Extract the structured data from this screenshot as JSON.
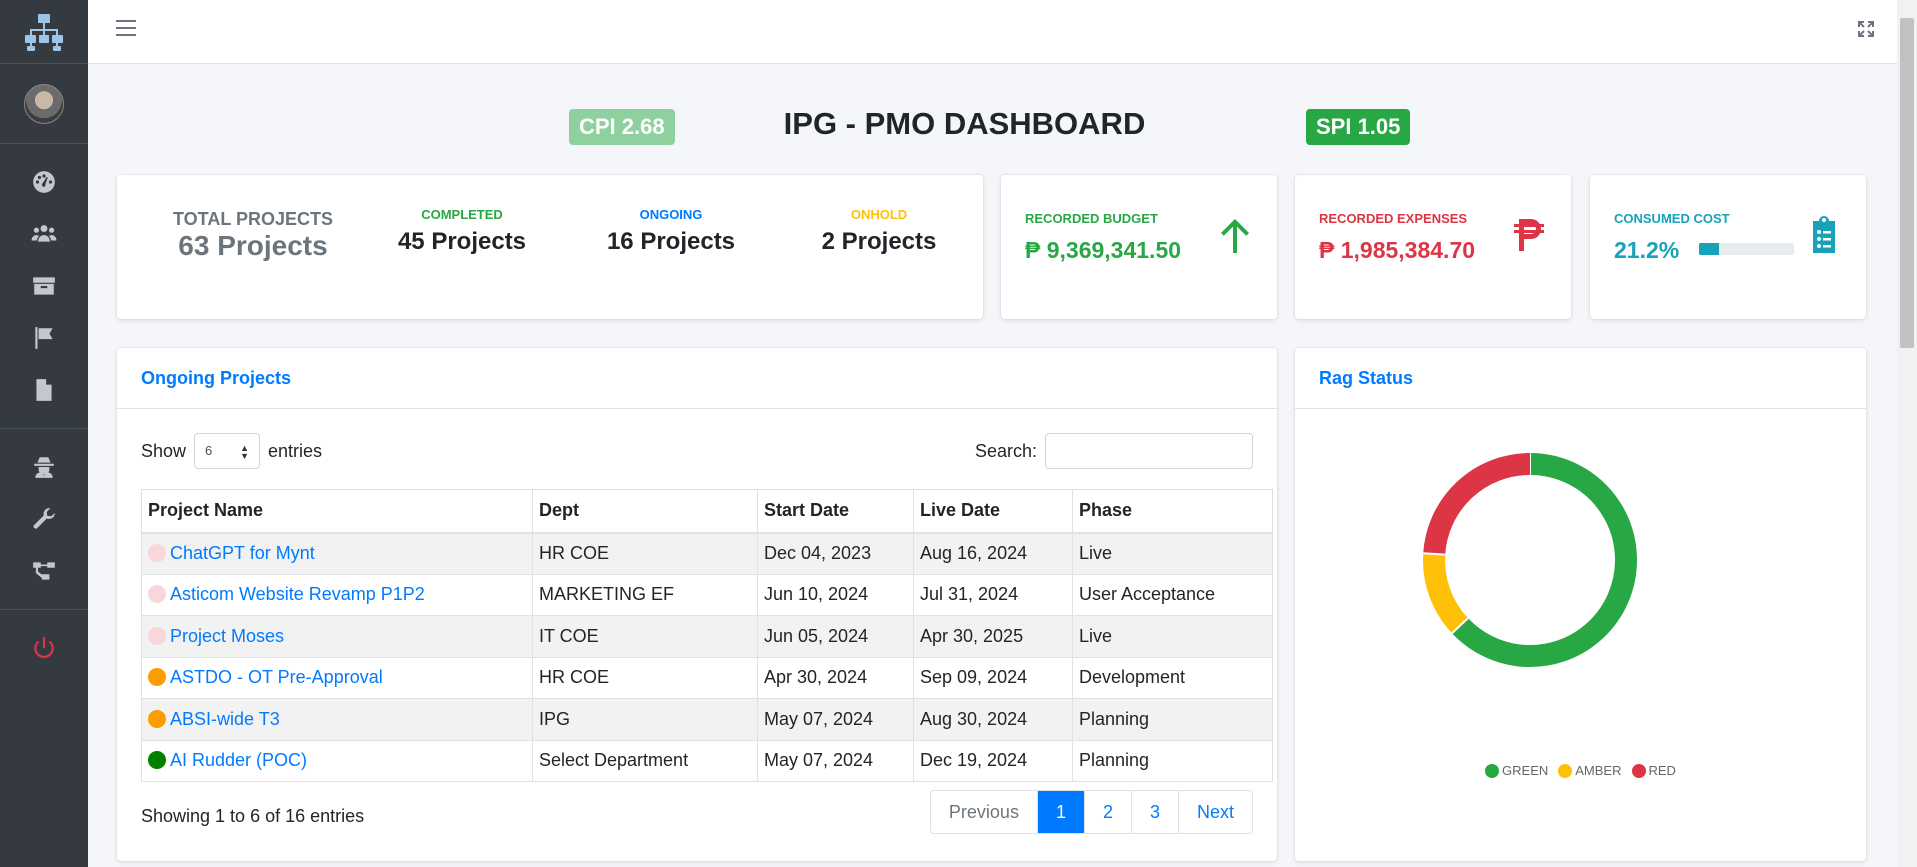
{
  "header": {
    "title": "IPG - PMO DASHBOARD",
    "cpi": "CPI 2.68",
    "spi": "SPI 1.05"
  },
  "stats": {
    "total_label": "TOTAL PROJECTS",
    "total_value": "63 Projects",
    "completed_label": "COMPLETED",
    "completed_value": "45 Projects",
    "ongoing_label": "ONGOING",
    "ongoing_value": "16 Projects",
    "onhold_label": "ONHOLD",
    "onhold_value": "2 Projects"
  },
  "budget": {
    "label": "RECORDED BUDGET",
    "value": "₱ 9,369,341.50"
  },
  "expenses": {
    "label": "RECORDED EXPENSES",
    "value": "₱ 1,985,384.70"
  },
  "consumed": {
    "label": "CONSUMED COST",
    "value": "21.2%",
    "fraction": 0.212
  },
  "ongoing_table": {
    "title": "Ongoing Projects",
    "show_label": "Show",
    "entries_value": "6",
    "entries_label": "entries",
    "search_label": "Search:",
    "search_value": "",
    "columns": [
      "Project Name",
      "Dept",
      "Start Date",
      "Live Date",
      "Phase"
    ],
    "rows": [
      {
        "status_color": "#f8d7da",
        "name": "ChatGPT for Mynt",
        "dept": "HR COE",
        "start": "Dec 04, 2023",
        "live": "Aug 16, 2024",
        "phase": "Live"
      },
      {
        "status_color": "#f8d7da",
        "name": "Asticom Website Revamp P1P2",
        "dept": "MARKETING EF",
        "start": "Jun 10, 2024",
        "live": "Jul 31, 2024",
        "phase": "User Acceptance"
      },
      {
        "status_color": "#f8d7da",
        "name": "Project Moses",
        "dept": "IT COE",
        "start": "Jun 05, 2024",
        "live": "Apr 30, 2025",
        "phase": "Live"
      },
      {
        "status_color": "#fd9c00",
        "name": "ASTDO - OT Pre-Approval",
        "dept": "HR COE",
        "start": "Apr 30, 2024",
        "live": "Sep 09, 2024",
        "phase": "Development"
      },
      {
        "status_color": "#fd9c00",
        "name": "ABSI-wide T3",
        "dept": "IPG",
        "start": "May 07, 2024",
        "live": "Aug 30, 2024",
        "phase": "Planning"
      },
      {
        "status_color": "#008000",
        "name": "AI Rudder (POC)",
        "dept": "Select Department",
        "start": "May 07, 2024",
        "live": "Dec 19, 2024",
        "phase": "Planning"
      }
    ],
    "showing": "Showing 1 to 6 of 16 entries",
    "pagination": {
      "previous": "Previous",
      "pages": [
        "1",
        "2",
        "3"
      ],
      "next": "Next",
      "active": "1"
    }
  },
  "rag": {
    "title": "Rag Status"
  },
  "chart_data": {
    "type": "pie",
    "categories": [
      "GREEN",
      "AMBER",
      "RED"
    ],
    "values": [
      63,
      13,
      24
    ],
    "colors": [
      "#28a745",
      "#ffc107",
      "#dc3545"
    ],
    "title": "Rag Status",
    "legend_position": "bottom"
  },
  "colors": {
    "primary": "#007bff",
    "success": "#28a745",
    "warning": "#ffc107",
    "danger": "#dc3545",
    "info": "#17a2b8",
    "sidebar": "#343a40"
  }
}
